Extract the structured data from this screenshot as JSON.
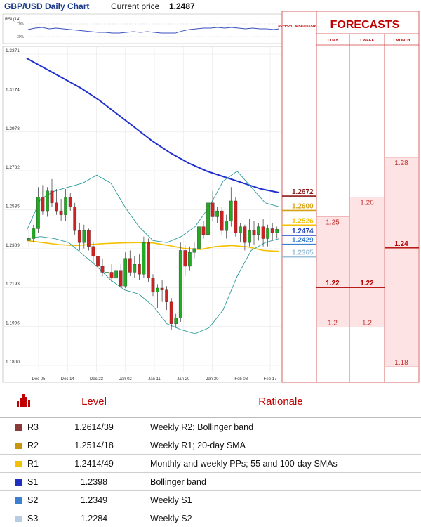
{
  "header": {
    "title": "GBP/USD Daily Chart",
    "price_label": "Current price",
    "price_value": "1.2487"
  },
  "rsi": {
    "label": "RSI (14)",
    "upper": "70%",
    "lower": "30%"
  },
  "support_header": "SUPPORT & RESISTANCE",
  "forecasts": {
    "title": "FORECASTS",
    "columns": [
      "1 DAY",
      "1 WEEK",
      "1 MONTH"
    ],
    "one_day": {
      "mean": "1.22",
      "high": "1.25",
      "low": "1.2"
    },
    "one_week": {
      "mean": "1.22",
      "high": "1.26",
      "low": "1.2"
    },
    "one_month": {
      "mean": "1.24",
      "high": "1.28",
      "low": "1.18"
    }
  },
  "sr_levels": [
    {
      "label": "1.2672",
      "color": "#8b1a1a"
    },
    {
      "label": "1.2600",
      "color": "#d4a017"
    },
    {
      "label": "1.2526",
      "color": "#f5c000"
    },
    {
      "label": "1.2474",
      "color": "#1f3fbf"
    },
    {
      "label": "1.2429",
      "color": "#3a7fd0"
    },
    {
      "label": "1.2365",
      "color": "#9dbfd8"
    }
  ],
  "chart_data": {
    "type": "candlestick",
    "title": "GBP/USD Daily Chart",
    "yticks": [
      "1.3371",
      "1.3174",
      "1.2978",
      "1.2782",
      "1.2585",
      "1.2389",
      "1.2193",
      "1.1996",
      "1.1800"
    ],
    "ylim": [
      1.18,
      1.3371
    ],
    "xticks": [
      "Dec 05",
      "Dec 14",
      "Dec 23",
      "Jan 02",
      "Jan 11",
      "Jan 20",
      "Jan 30",
      "Feb 08",
      "Feb 17"
    ],
    "current_price": 1.2487,
    "candles": [
      {
        "o": 1.243,
        "h": 1.248,
        "l": 1.2395,
        "c": 1.244
      },
      {
        "o": 1.244,
        "h": 1.251,
        "l": 1.242,
        "c": 1.249
      },
      {
        "o": 1.249,
        "h": 1.27,
        "l": 1.247,
        "c": 1.265
      },
      {
        "o": 1.265,
        "h": 1.271,
        "l": 1.256,
        "c": 1.258
      },
      {
        "o": 1.258,
        "h": 1.27,
        "l": 1.255,
        "c": 1.268
      },
      {
        "o": 1.268,
        "h": 1.274,
        "l": 1.26,
        "c": 1.262
      },
      {
        "o": 1.262,
        "h": 1.269,
        "l": 1.256,
        "c": 1.258
      },
      {
        "o": 1.258,
        "h": 1.264,
        "l": 1.253,
        "c": 1.256
      },
      {
        "o": 1.256,
        "h": 1.269,
        "l": 1.253,
        "c": 1.265
      },
      {
        "o": 1.265,
        "h": 1.267,
        "l": 1.258,
        "c": 1.26
      },
      {
        "o": 1.26,
        "h": 1.262,
        "l": 1.246,
        "c": 1.248
      },
      {
        "o": 1.248,
        "h": 1.252,
        "l": 1.238,
        "c": 1.242
      },
      {
        "o": 1.242,
        "h": 1.251,
        "l": 1.239,
        "c": 1.248
      },
      {
        "o": 1.248,
        "h": 1.249,
        "l": 1.238,
        "c": 1.24
      },
      {
        "o": 1.24,
        "h": 1.242,
        "l": 1.232,
        "c": 1.235
      },
      {
        "o": 1.235,
        "h": 1.238,
        "l": 1.229,
        "c": 1.23
      },
      {
        "o": 1.23,
        "h": 1.234,
        "l": 1.225,
        "c": 1.227
      },
      {
        "o": 1.227,
        "h": 1.23,
        "l": 1.223,
        "c": 1.227
      },
      {
        "o": 1.227,
        "h": 1.231,
        "l": 1.222,
        "c": 1.224
      },
      {
        "o": 1.224,
        "h": 1.23,
        "l": 1.218,
        "c": 1.228
      },
      {
        "o": 1.228,
        "h": 1.231,
        "l": 1.219,
        "c": 1.22
      },
      {
        "o": 1.22,
        "h": 1.237,
        "l": 1.219,
        "c": 1.234
      },
      {
        "o": 1.234,
        "h": 1.238,
        "l": 1.225,
        "c": 1.227
      },
      {
        "o": 1.227,
        "h": 1.235,
        "l": 1.224,
        "c": 1.231
      },
      {
        "o": 1.231,
        "h": 1.236,
        "l": 1.223,
        "c": 1.226
      },
      {
        "o": 1.226,
        "h": 1.245,
        "l": 1.224,
        "c": 1.242
      },
      {
        "o": 1.242,
        "h": 1.244,
        "l": 1.222,
        "c": 1.224
      },
      {
        "o": 1.224,
        "h": 1.226,
        "l": 1.215,
        "c": 1.217
      },
      {
        "o": 1.217,
        "h": 1.221,
        "l": 1.209,
        "c": 1.219
      },
      {
        "o": 1.219,
        "h": 1.223,
        "l": 1.212,
        "c": 1.218
      },
      {
        "o": 1.218,
        "h": 1.22,
        "l": 1.208,
        "c": 1.212
      },
      {
        "o": 1.212,
        "h": 1.214,
        "l": 1.198,
        "c": 1.201
      },
      {
        "o": 1.201,
        "h": 1.206,
        "l": 1.199,
        "c": 1.204
      },
      {
        "o": 1.204,
        "h": 1.242,
        "l": 1.202,
        "c": 1.238
      },
      {
        "o": 1.238,
        "h": 1.241,
        "l": 1.225,
        "c": 1.23
      },
      {
        "o": 1.23,
        "h": 1.24,
        "l": 1.228,
        "c": 1.237
      },
      {
        "o": 1.237,
        "h": 1.242,
        "l": 1.234,
        "c": 1.239
      },
      {
        "o": 1.239,
        "h": 1.252,
        "l": 1.236,
        "c": 1.25
      },
      {
        "o": 1.25,
        "h": 1.253,
        "l": 1.244,
        "c": 1.246
      },
      {
        "o": 1.246,
        "h": 1.264,
        "l": 1.244,
        "c": 1.262
      },
      {
        "o": 1.262,
        "h": 1.268,
        "l": 1.253,
        "c": 1.255
      },
      {
        "o": 1.255,
        "h": 1.26,
        "l": 1.252,
        "c": 1.258
      },
      {
        "o": 1.258,
        "h": 1.26,
        "l": 1.246,
        "c": 1.248
      },
      {
        "o": 1.248,
        "h": 1.256,
        "l": 1.244,
        "c": 1.253
      },
      {
        "o": 1.253,
        "h": 1.27,
        "l": 1.25,
        "c": 1.263
      },
      {
        "o": 1.263,
        "h": 1.265,
        "l": 1.245,
        "c": 1.247
      },
      {
        "o": 1.247,
        "h": 1.252,
        "l": 1.242,
        "c": 1.25
      },
      {
        "o": 1.25,
        "h": 1.251,
        "l": 1.238,
        "c": 1.242
      },
      {
        "o": 1.242,
        "h": 1.254,
        "l": 1.24,
        "c": 1.248
      },
      {
        "o": 1.248,
        "h": 1.253,
        "l": 1.241,
        "c": 1.246
      },
      {
        "o": 1.246,
        "h": 1.252,
        "l": 1.243,
        "c": 1.25
      },
      {
        "o": 1.25,
        "h": 1.254,
        "l": 1.24,
        "c": 1.244
      },
      {
        "o": 1.244,
        "h": 1.251,
        "l": 1.24,
        "c": 1.249
      },
      {
        "o": 1.249,
        "h": 1.252,
        "l": 1.243,
        "c": 1.247
      },
      {
        "o": 1.247,
        "h": 1.25,
        "l": 1.244,
        "c": 1.2487
      }
    ],
    "series": [
      {
        "name": "SMA 200",
        "color": "#1f2fcf",
        "values": [
          1.335,
          1.33,
          1.325,
          1.32,
          1.314,
          1.307,
          1.3,
          1.293,
          1.287,
          1.282,
          1.278,
          1.275,
          1.272,
          1.269,
          1.2672
        ]
      },
      {
        "name": "SMA 100",
        "color": "#f5c000",
        "values": [
          1.243,
          1.242,
          1.241,
          1.2405,
          1.241,
          1.2415,
          1.2418,
          1.242,
          1.2418,
          1.2405,
          1.239,
          1.2385,
          1.24,
          1.2405,
          1.2398,
          1.238,
          1.2375
        ]
      },
      {
        "name": "Bollinger upper",
        "color": "#2a9a9a",
        "values": [
          1.248,
          1.264,
          1.268,
          1.27,
          1.272,
          1.276,
          1.272,
          1.26,
          1.25,
          1.243,
          1.242,
          1.245,
          1.25,
          1.26,
          1.273,
          1.278,
          1.27,
          1.262,
          1.26
        ]
      },
      {
        "name": "Bollinger lower",
        "color": "#2a9a9a",
        "values": [
          1.244,
          1.245,
          1.244,
          1.242,
          1.236,
          1.23,
          1.223,
          1.218,
          1.216,
          1.21,
          1.201,
          1.198,
          1.196,
          1.199,
          1.208,
          1.225,
          1.238,
          1.242,
          1.244
        ]
      }
    ]
  },
  "table": {
    "headers": {
      "level": "Level",
      "rationale": "Rationale"
    },
    "rows": [
      {
        "name": "R3",
        "level": "1.2614/39",
        "rationale": "Weekly R2; Bollinger band",
        "color": "#8b3a3a"
      },
      {
        "name": "R2",
        "level": "1.2514/18",
        "rationale": "Weekly R1; 20-day SMA",
        "color": "#c8960c"
      },
      {
        "name": "R1",
        "level": "1.2414/49",
        "rationale": "Monthly and weekly PPs; 55 and 100-day SMAs",
        "color": "#f5c000"
      },
      {
        "name": "S1",
        "level": "1.2398",
        "rationale": "Bollinger band",
        "color": "#1f2fbf"
      },
      {
        "name": "S2",
        "level": "1.2349",
        "rationale": "Weekly S1",
        "color": "#3a7fd0"
      },
      {
        "name": "S3",
        "level": "1.2284",
        "rationale": "Weekly S2",
        "color": "#b8cce4"
      }
    ]
  }
}
